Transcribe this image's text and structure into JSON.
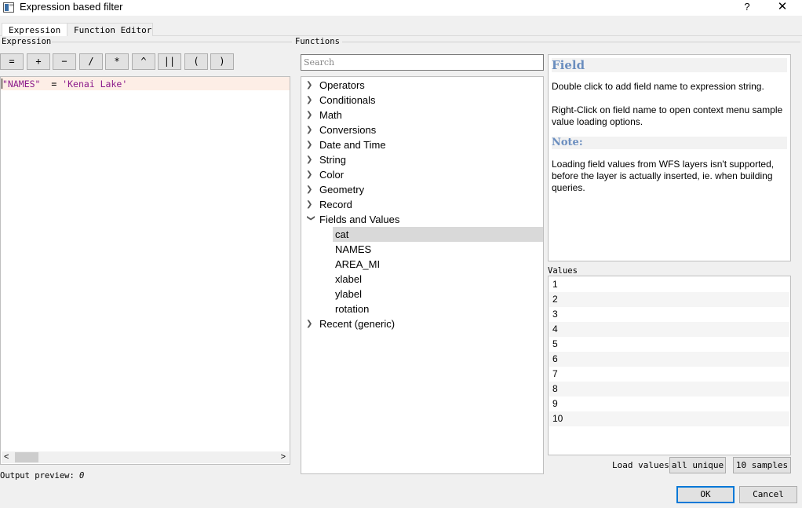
{
  "window": {
    "title": "Expression based filter",
    "help": "?",
    "close": "✕"
  },
  "tabs": [
    {
      "label": "Expression",
      "active": true
    },
    {
      "label": "Function Editor",
      "active": false
    }
  ],
  "expression": {
    "group_label": "Expression",
    "operators": [
      "=",
      "+",
      "−",
      "/",
      "*",
      "^",
      "||",
      "(",
      ")"
    ],
    "code": {
      "field": "\"NAMES\"",
      "op": "  = ",
      "string": "'Kenai Lake'"
    },
    "scroll_left": "<",
    "scroll_right": ">",
    "preview_label": "Output preview:",
    "preview_value": "0"
  },
  "functions": {
    "group_label": "Functions",
    "search_placeholder": "Search",
    "tree": [
      {
        "label": "Operators",
        "expanded": false
      },
      {
        "label": "Conditionals",
        "expanded": false
      },
      {
        "label": "Math",
        "expanded": false
      },
      {
        "label": "Conversions",
        "expanded": false
      },
      {
        "label": "Date and Time",
        "expanded": false
      },
      {
        "label": "String",
        "expanded": false
      },
      {
        "label": "Color",
        "expanded": false
      },
      {
        "label": "Geometry",
        "expanded": false
      },
      {
        "label": "Record",
        "expanded": false
      },
      {
        "label": "Fields and Values",
        "expanded": true,
        "children": [
          "cat",
          "NAMES",
          "AREA_MI",
          "xlabel",
          "ylabel",
          "rotation"
        ],
        "selected": "cat"
      },
      {
        "label": "Recent (generic)",
        "expanded": false
      }
    ]
  },
  "help": {
    "field_heading": "Field",
    "p1": "Double click to add field name to expression string.",
    "p2": "Right-Click on field name to open context menu sample value loading options.",
    "note_heading": "Note:",
    "p3": "Loading field values from WFS layers isn't supported, before the layer is actually inserted, ie. when building queries.",
    "heading_color": "#6b8ebf"
  },
  "values": {
    "label": "Values",
    "items": [
      "1",
      "2",
      "3",
      "4",
      "5",
      "6",
      "7",
      "8",
      "9",
      "10"
    ],
    "load_label": "Load values",
    "all_unique": "all unique",
    "samples": "10 samples"
  },
  "buttons": {
    "ok": "OK",
    "cancel": "Cancel",
    "accent": "#0078d7"
  }
}
